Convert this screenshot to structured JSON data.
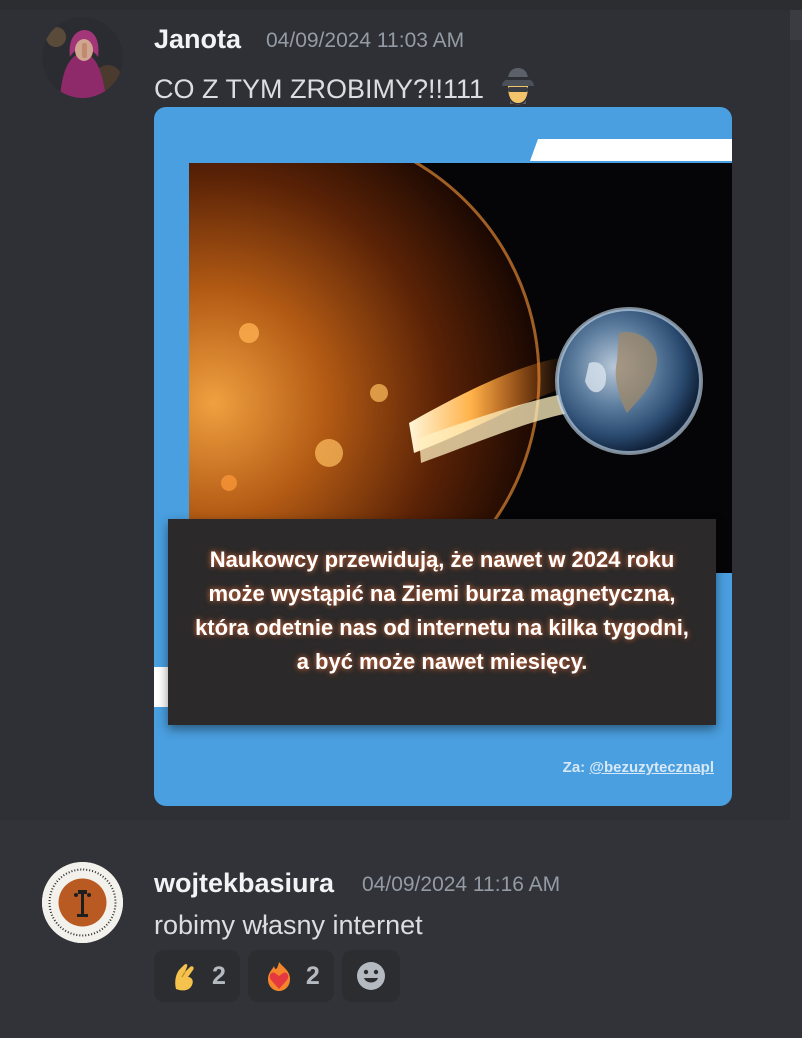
{
  "messages": [
    {
      "author": "Janota",
      "timestamp": "04/09/2024 11:03 AM",
      "content": "CO Z TYM ZROBIMY?!!111",
      "content_emoji": "detective-emoji",
      "attachment": {
        "caption": "Naukowcy przewidują, że nawet w 2024 roku może wystąpić na Ziemi burza magnetyczna, która odetnie nas od internetu na kilka tygodni, a być może nawet miesięcy.",
        "credit_prefix": "Za: ",
        "credit_handle": "@bezuzytecznapl"
      }
    },
    {
      "author": "wojtekbasiura",
      "timestamp": "04/09/2024 11:16 AM",
      "content": "robimy własny internet",
      "reactions": [
        {
          "icon": "pinching-hand-emoji",
          "count": "2"
        },
        {
          "icon": "heart-on-fire-emoji",
          "count": "2"
        }
      ],
      "add_reaction_icon": "smiley-icon"
    }
  ],
  "colors": {
    "background": "#313338",
    "username": "#f2f3f5",
    "timestamp": "#949ba4",
    "embed_blue": "#4a9fe0"
  }
}
